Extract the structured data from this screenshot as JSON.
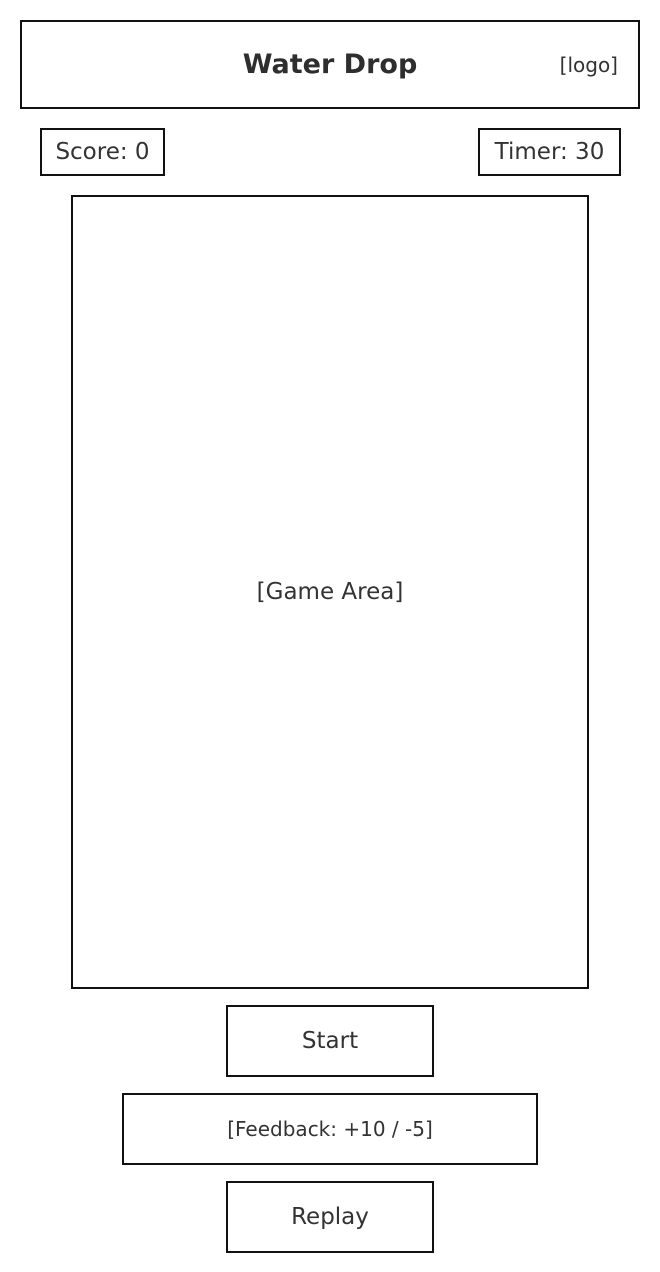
{
  "header": {
    "title": "Water Drop",
    "logo_placeholder": "[logo]"
  },
  "stats": {
    "score": "Score: 0",
    "timer": "Timer: 30"
  },
  "game": {
    "area_label": "[Game Area]"
  },
  "controls": {
    "start_label": "Start",
    "feedback_text": "[Feedback: +10 / -5]",
    "replay_label": "Replay"
  }
}
